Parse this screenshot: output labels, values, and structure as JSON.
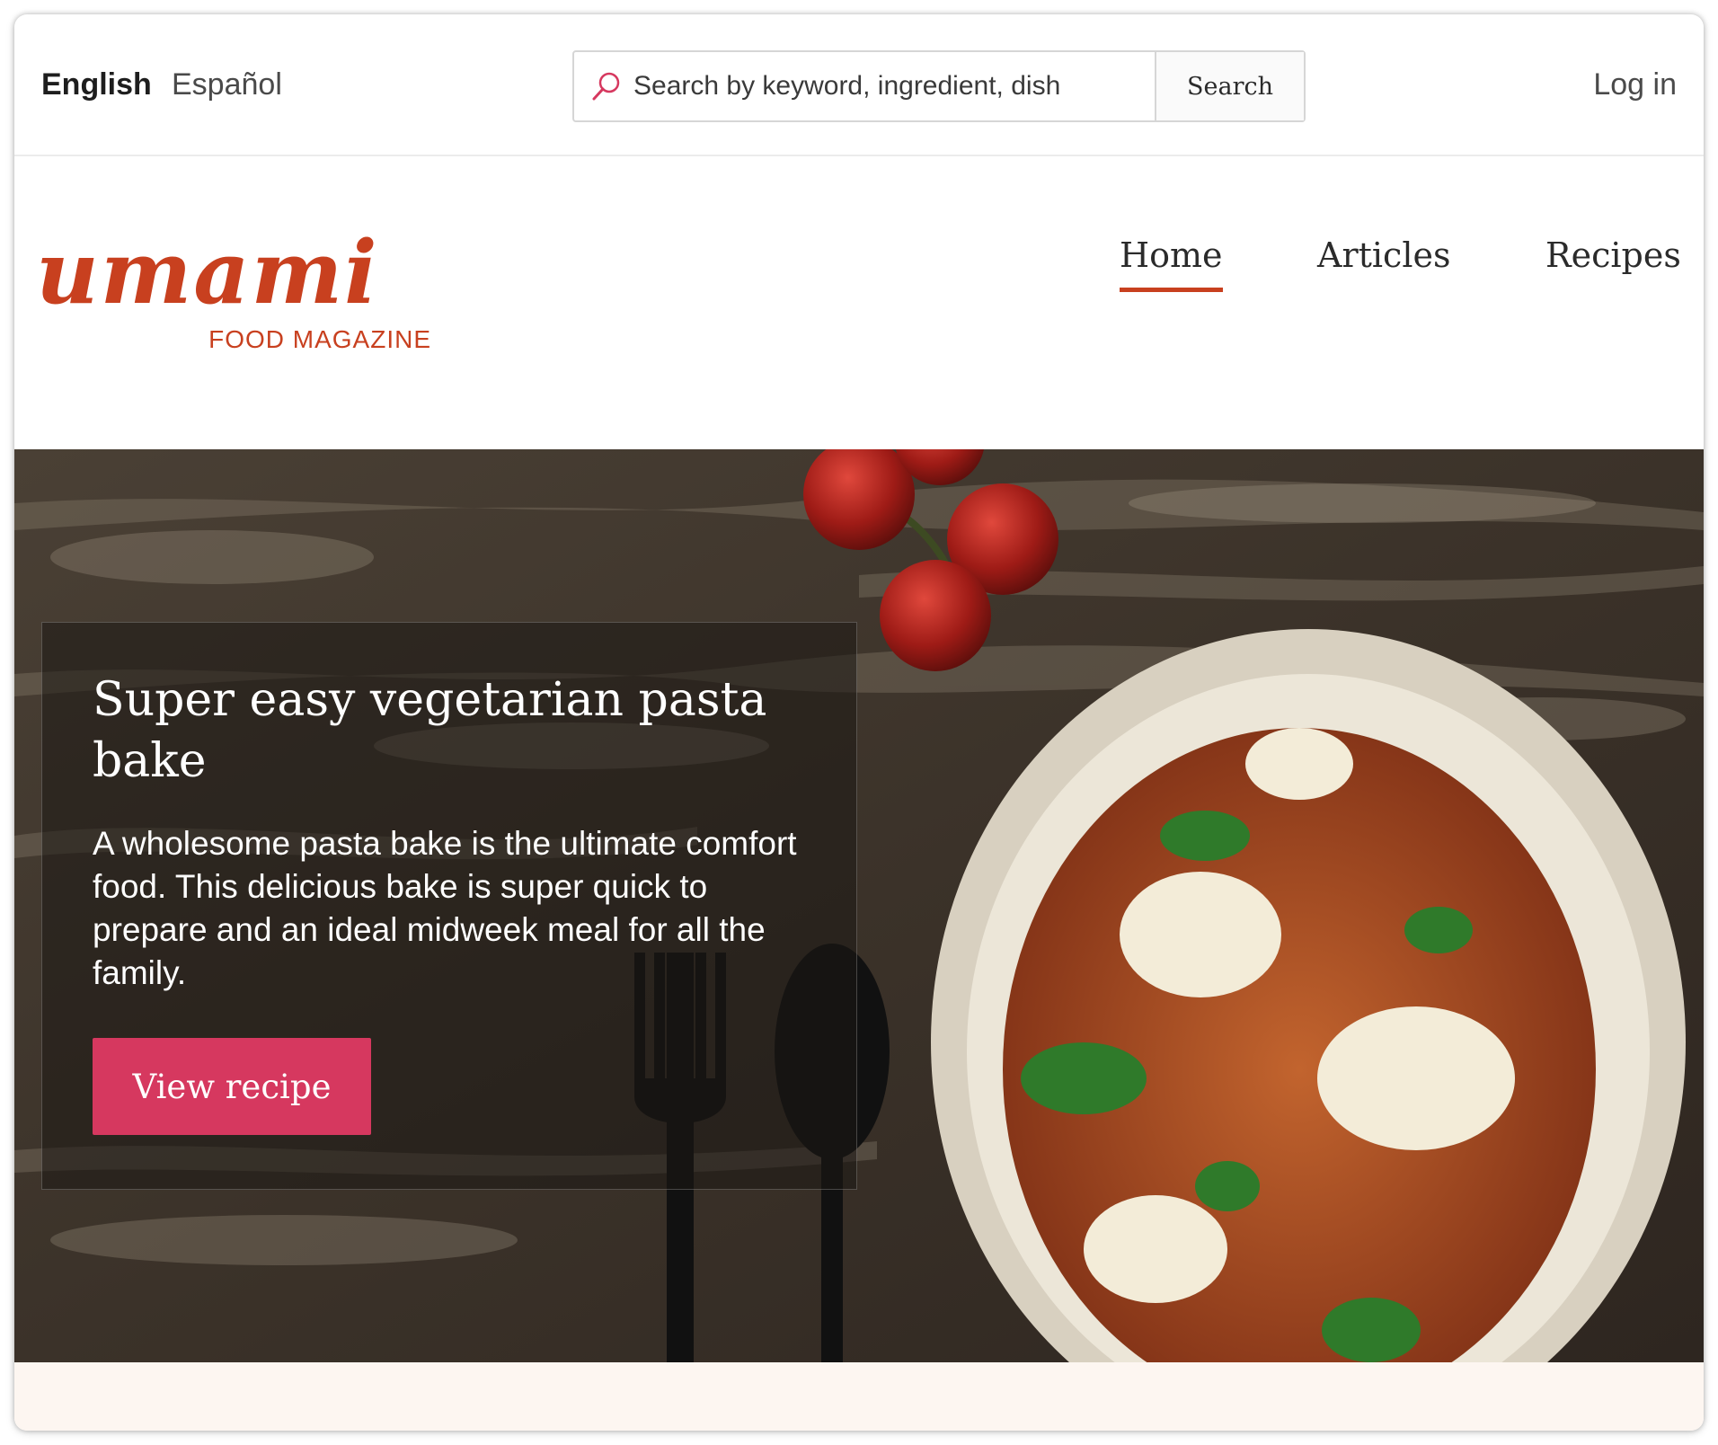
{
  "colors": {
    "brand": "#c8401f",
    "cta": "#d6385f",
    "footer_band": "#fdf6f1"
  },
  "topbar": {
    "languages": [
      {
        "label": "English",
        "active": true
      },
      {
        "label": "Español",
        "active": false
      }
    ],
    "search": {
      "placeholder": "Search by keyword, ingredient, dish",
      "button_label": "Search",
      "icon": "search-icon"
    },
    "login_label": "Log in"
  },
  "header": {
    "logo": {
      "script": "umami",
      "tagline": "FOOD MAGAZINE"
    },
    "nav": [
      {
        "label": "Home",
        "active": true
      },
      {
        "label": "Articles",
        "active": false
      },
      {
        "label": "Recipes",
        "active": false
      }
    ]
  },
  "hero": {
    "title": "Super easy vegetarian pasta bake",
    "description": "A wholesome pasta bake is the ultimate comfort food. This delicious bake is super quick to prepare and an ideal midweek meal for all the family.",
    "cta_label": "View recipe"
  }
}
